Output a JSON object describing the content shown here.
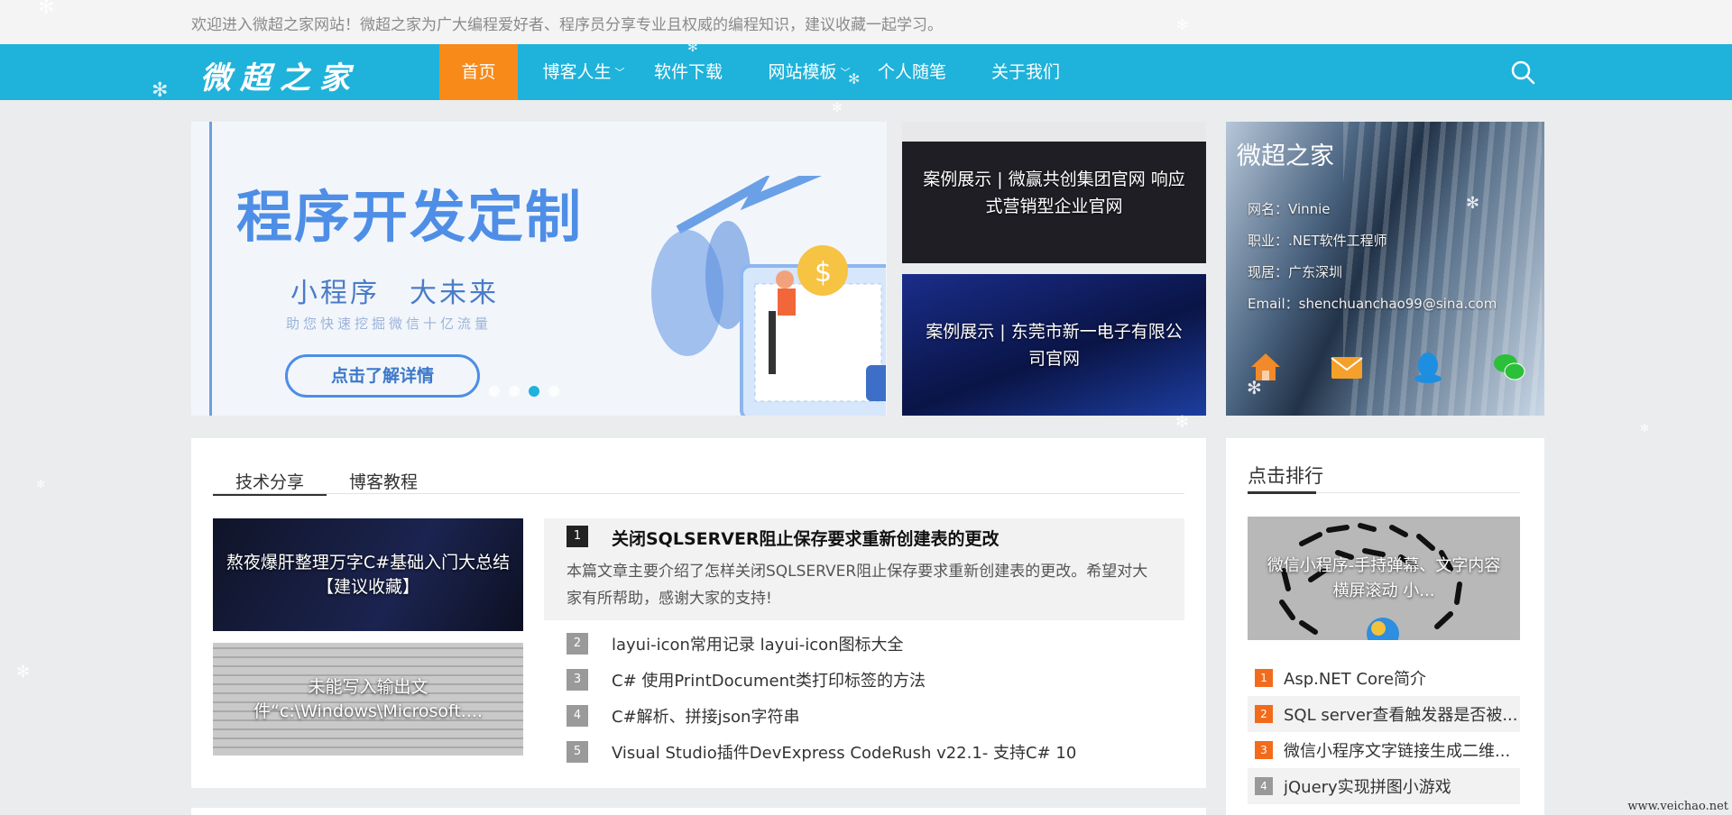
{
  "topbar": {
    "welcome": "欢迎进入微超之家网站！微超之家为广大编程爱好者、程序员分享专业且权威的编程知识，建议收藏一起学习。"
  },
  "nav": {
    "logo": "微超之家",
    "items": [
      {
        "label": "首页",
        "active": true
      },
      {
        "label": "博客人生",
        "dropdown": true
      },
      {
        "label": "软件下载"
      },
      {
        "label": "网站模板",
        "dropdown": true
      },
      {
        "label": "个人随笔"
      },
      {
        "label": "关于我们"
      }
    ],
    "search_icon": "search-icon"
  },
  "hero": {
    "headline": "程序开发定制",
    "subline": "小程序　大未来",
    "tagline": "助您快速挖掘微信十亿流量",
    "cta": "点击了解详情",
    "active_slide": 3,
    "slide_count": 4
  },
  "cases": [
    {
      "title": "案例展示 | 微赢共创集团官网 响应式营销型企业官网"
    },
    {
      "title": "案例展示 | 东莞市新一电子有限公司官网"
    }
  ],
  "profile": {
    "name": "微超之家",
    "fields": [
      {
        "label": "网名：",
        "value": "Vinnie"
      },
      {
        "label": "职业：",
        "value": ".NET软件工程师"
      },
      {
        "label": "现居：",
        "value": "广东深圳"
      },
      {
        "label": "Email：",
        "value": "shenchuanchao99@sina.com"
      }
    ],
    "icons": [
      "home-icon",
      "mail-icon",
      "qq-icon",
      "wechat-icon"
    ]
  },
  "main": {
    "tabs": [
      {
        "label": "技术分享",
        "active": true
      },
      {
        "label": "博客教程"
      }
    ],
    "thumbs": [
      {
        "caption": "熬夜爆肝整理万字C#基础入门大总结【建议收藏】"
      },
      {
        "caption": "未能写入输出文件“c:\\Windows\\Microsoft...."
      }
    ],
    "featured": {
      "num": "1",
      "title": "关闭SQLSERVER阻止保存要求重新创建表的更改",
      "desc": "本篇文章主要介绍了怎样关闭SQLSERVER阻止保存要求重新创建表的更改。希望对大家有所帮助，感谢大家的支持!"
    },
    "articles": [
      {
        "num": "2",
        "title": "layui-icon常用记录 layui-icon图标大全"
      },
      {
        "num": "3",
        "title": "C# 使用PrintDocument类打印标签的方法"
      },
      {
        "num": "4",
        "title": "C#解析、拼接json字符串"
      },
      {
        "num": "5",
        "title": "Visual Studio插件DevExpress CodeRush v22.1- 支持C# 10"
      }
    ]
  },
  "sidebar": {
    "heading": "点击排行",
    "featured_caption": "微信小程序-手持弹幕、文字内容横屏滚动 小...",
    "ranks": [
      {
        "num": "1",
        "title": "Asp.NET Core简介"
      },
      {
        "num": "2",
        "title": "SQL server查看触发器是否被..."
      },
      {
        "num": "3",
        "title": "微信小程序文字链接生成二维..."
      },
      {
        "num": "4",
        "title": "jQuery实现拼图小游戏"
      }
    ]
  },
  "watermark": "www.veichao.net",
  "colors": {
    "nav_bg": "#1fb2da",
    "nav_active": "#f88a1a",
    "rank_badge": "#f26b1d"
  }
}
